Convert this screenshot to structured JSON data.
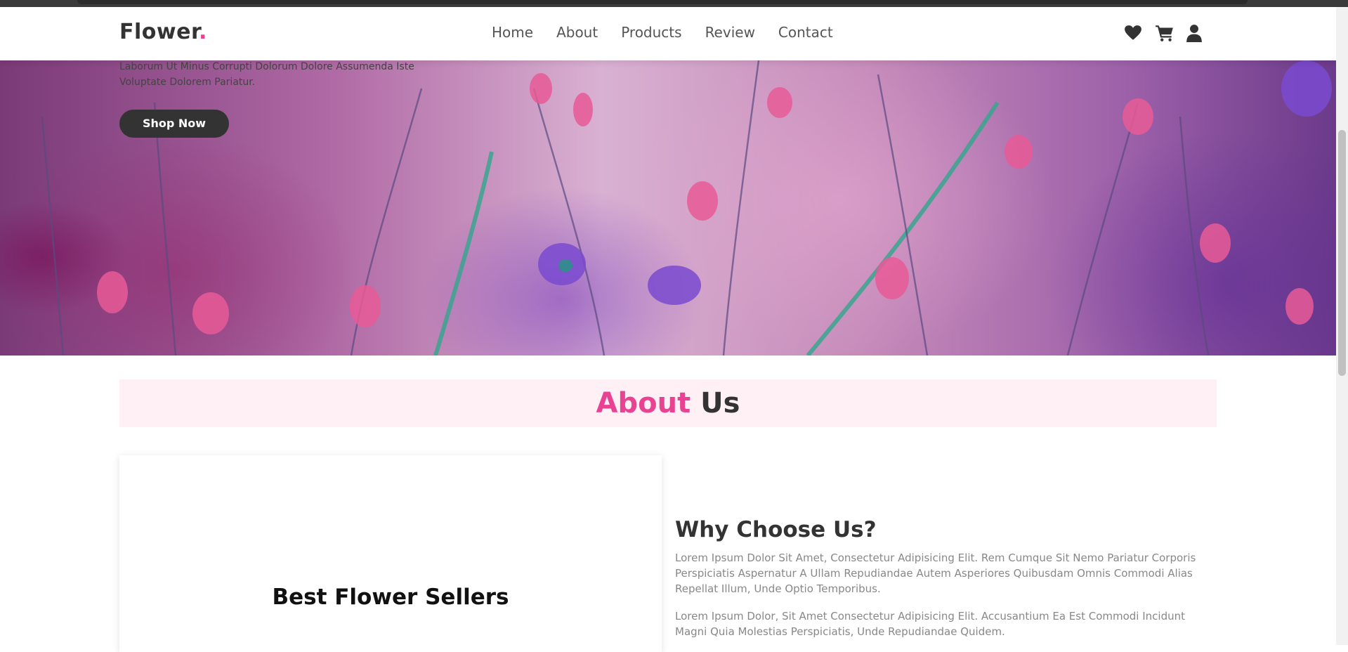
{
  "header": {
    "logo_text": "Flower",
    "logo_dot": ".",
    "nav": [
      {
        "label": "Home"
      },
      {
        "label": "About"
      },
      {
        "label": "Products"
      },
      {
        "label": "Review"
      },
      {
        "label": "Contact"
      }
    ],
    "icons": [
      "heart-icon",
      "cart-icon",
      "user-icon"
    ]
  },
  "hero": {
    "description": "Laborum Ut Minus Corrupti Dolorum Dolore Assumenda Iste Voluptate Dolorem Pariatur.",
    "cta_label": "Shop Now"
  },
  "about": {
    "heading_accent": "About",
    "heading_rest": "Us",
    "video_card_title": "Best Flower Sellers",
    "why_title": "Why Choose Us?",
    "paragraph1": "Lorem Ipsum Dolor Sit Amet, Consectetur Adipisicing Elit. Rem Cumque Sit Nemo Pariatur Corporis Perspiciatis Aspernatur A Ullam Repudiandae Autem Asperiores Quibusdam Omnis Commodi Alias Repellat Illum, Unde Optio Temporibus.",
    "paragraph2": "Lorem Ipsum Dolor, Sit Amet Consectetur Adipisicing Elit. Accusantium Ea Est Commodi Incidunt Magni Quia Molestias Perspiciatis, Unde Repudiandae Quidem."
  },
  "colors": {
    "accent": "#e84393",
    "dark": "#333333",
    "heading_band": "#fff0f6"
  }
}
